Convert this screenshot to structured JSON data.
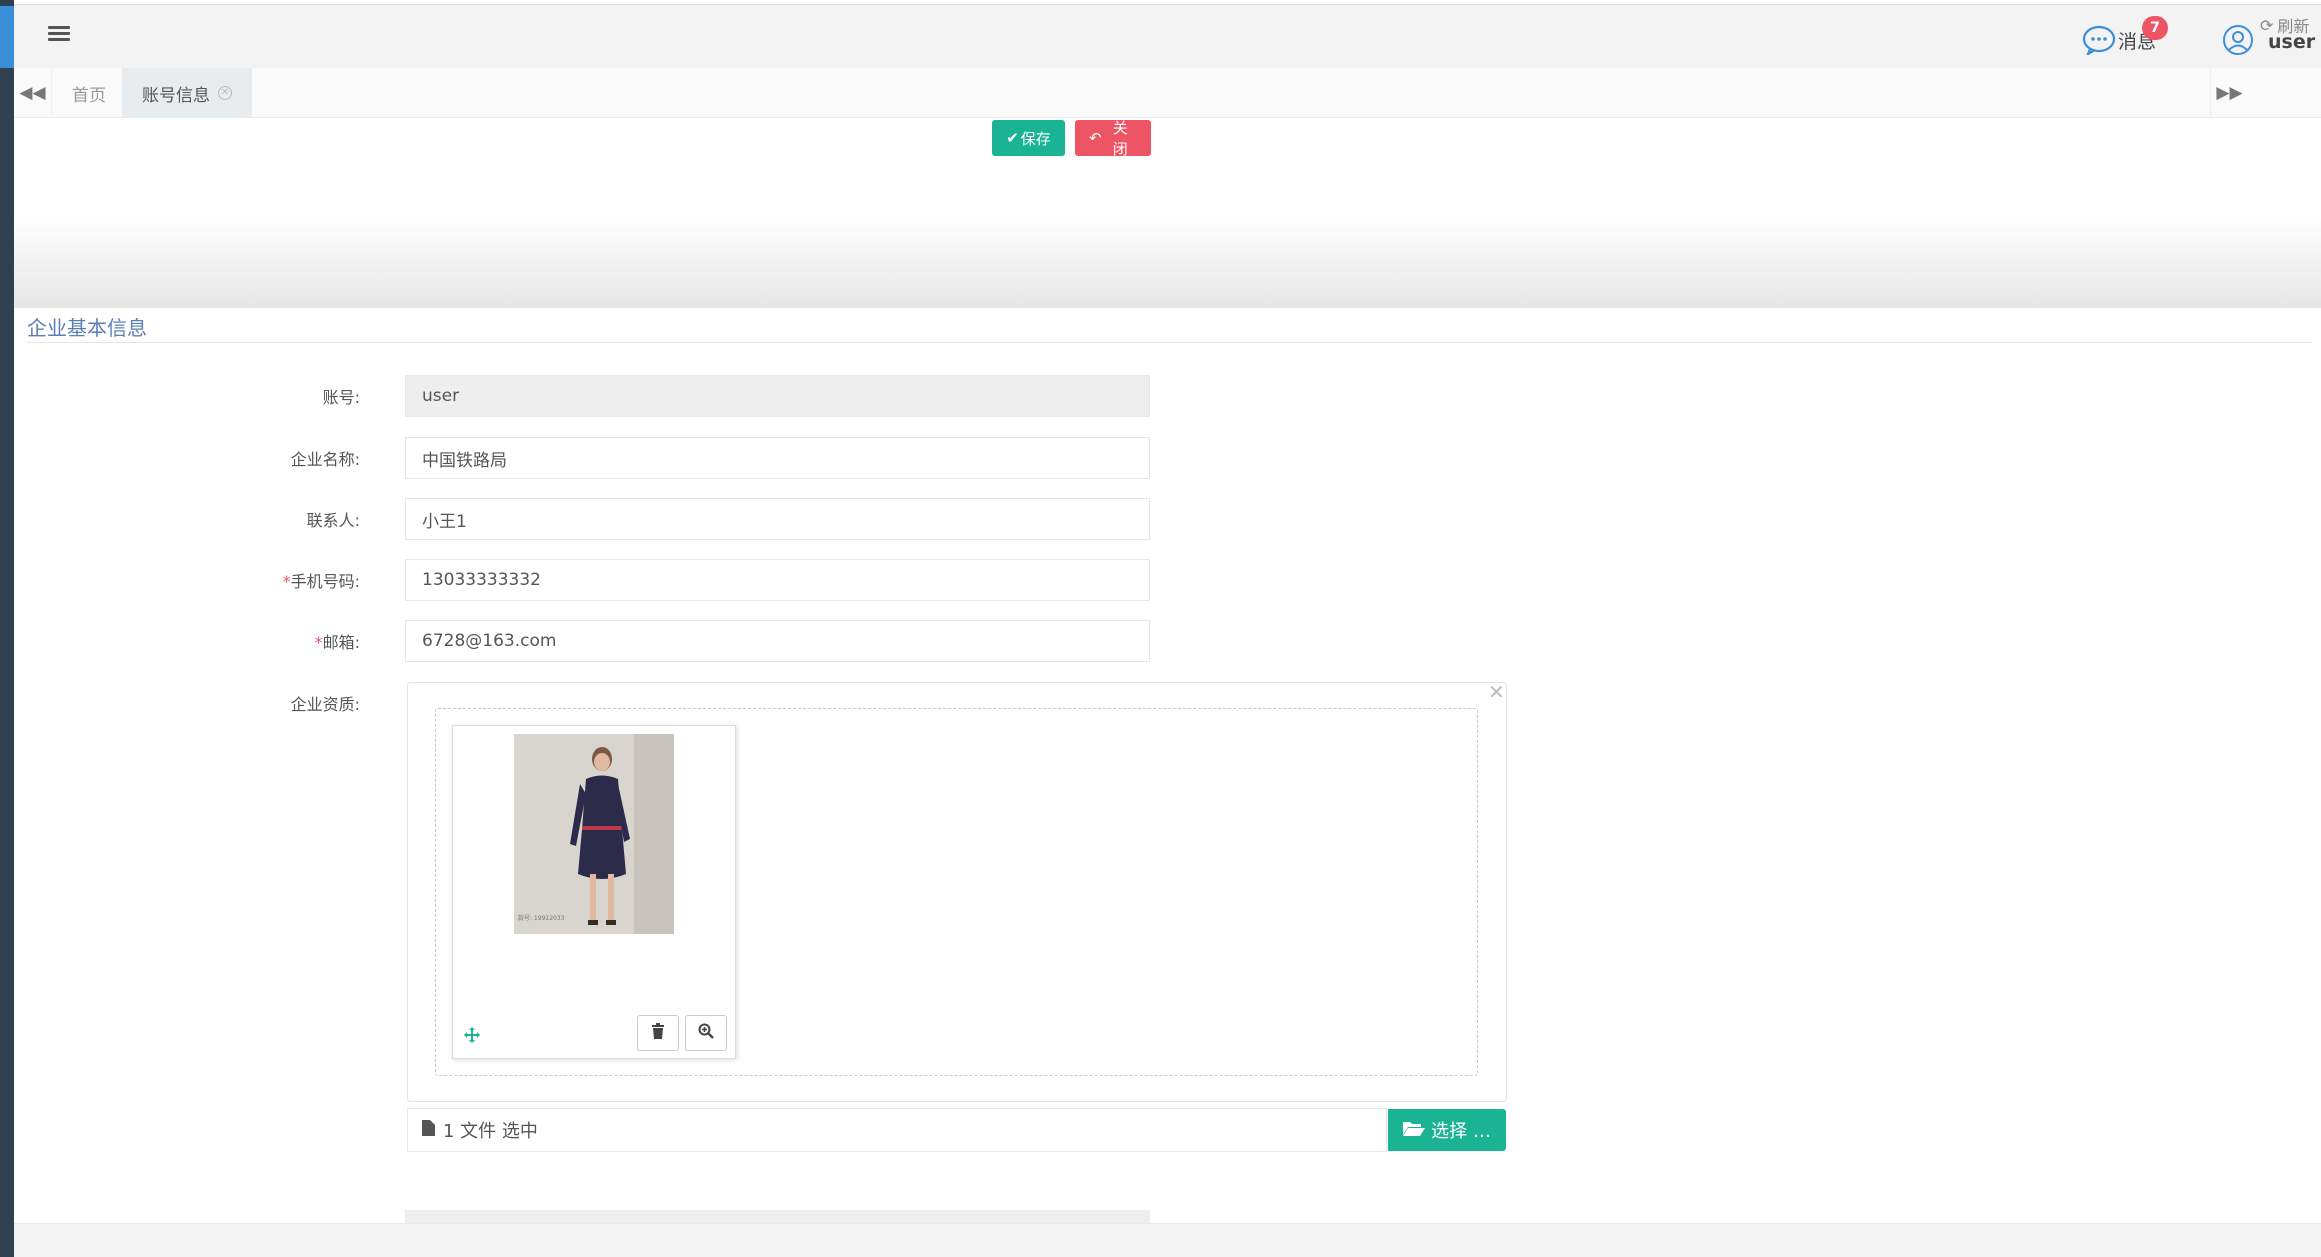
{
  "header": {
    "messages_label": "消息",
    "messages_count": "7",
    "user_name": "user"
  },
  "tabs": {
    "items": [
      {
        "label": "首页"
      },
      {
        "label": "账号信息"
      }
    ],
    "refresh_label": "刷新"
  },
  "toolbar": {
    "save_label": "保存",
    "close_label": "关 闭"
  },
  "section": {
    "title": "企业基本信息"
  },
  "form": {
    "account": {
      "label": "账号:",
      "value": "user"
    },
    "company": {
      "label": "企业名称:",
      "value": "中国铁路局"
    },
    "contact": {
      "label": "联系人:",
      "value": "小王1"
    },
    "phone": {
      "label": "手机号码:",
      "required": "*",
      "value": "13033333332"
    },
    "email": {
      "label": "邮箱:",
      "required": "*",
      "value": "6728@163.com"
    },
    "qualification": {
      "label": "企业资质:"
    }
  },
  "upload": {
    "caption": "1 文件 选中",
    "choose_label": "选择 …",
    "image_caption": "款号: 19912033"
  },
  "colors": {
    "primary": "#1ab394",
    "danger": "#ed5565",
    "section_title": "#5b7fb5",
    "sidebar": "#2f4050"
  }
}
